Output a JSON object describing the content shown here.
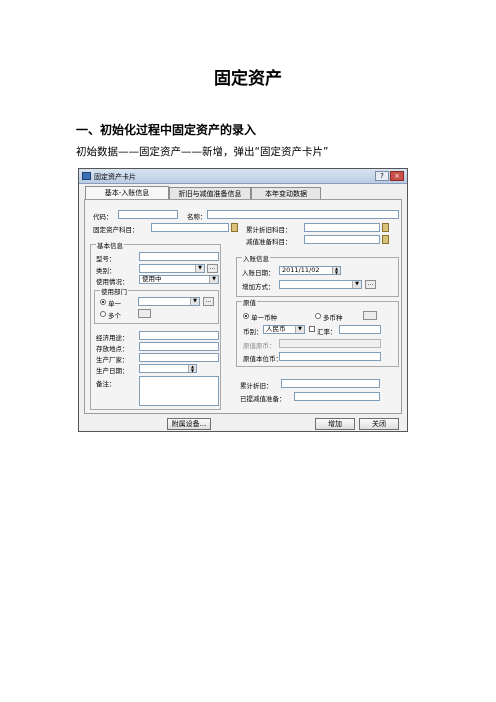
{
  "doc": {
    "title": "固定资产",
    "section_heading": "一、初始化过程中固定资产的录入",
    "body_line": "初始数据——固定资产——新增，弹出“固定资产卡片”"
  },
  "dialog": {
    "title": "固定资产卡片",
    "tabs": [
      "基本-入账信息",
      "折旧与减值准备信息",
      "本年变动数据"
    ],
    "fields": {
      "code": "代码：",
      "name": "名称：",
      "asset_account": "固定资产科目：",
      "accum_depr_account": "累计折旧科目：",
      "impairment_account": "减值准备科目："
    },
    "basic": {
      "group": "基本信息",
      "model": "型号：",
      "category": "类别：",
      "usage_status": "使用情况：",
      "usage_status_value": "使用中",
      "dept_group": "使用部门",
      "single": "单一",
      "multiple": "多个",
      "economic_use": "经济用途：",
      "location": "存放地点：",
      "manufacturer": "生产厂家：",
      "production_date": "生产日期：",
      "remark": "备注："
    },
    "entry": {
      "group": "入账信息",
      "entry_date": "入账日期：",
      "entry_date_value": "2011/11/02",
      "add_method": "增加方式："
    },
    "original": {
      "group": "原值",
      "single_currency": "单一币种",
      "multi_currency": "多币种",
      "currency": "币别：",
      "currency_value": "人民币",
      "rate": "汇率：",
      "original_amount": "原值原币：",
      "local_amount": "原值本位币："
    },
    "depr": {
      "accum": "累计折旧：",
      "impairment": "已提减值准备："
    },
    "buttons": {
      "attached_equipment": "附属设备...",
      "add": "增加",
      "close": "关闭"
    }
  }
}
